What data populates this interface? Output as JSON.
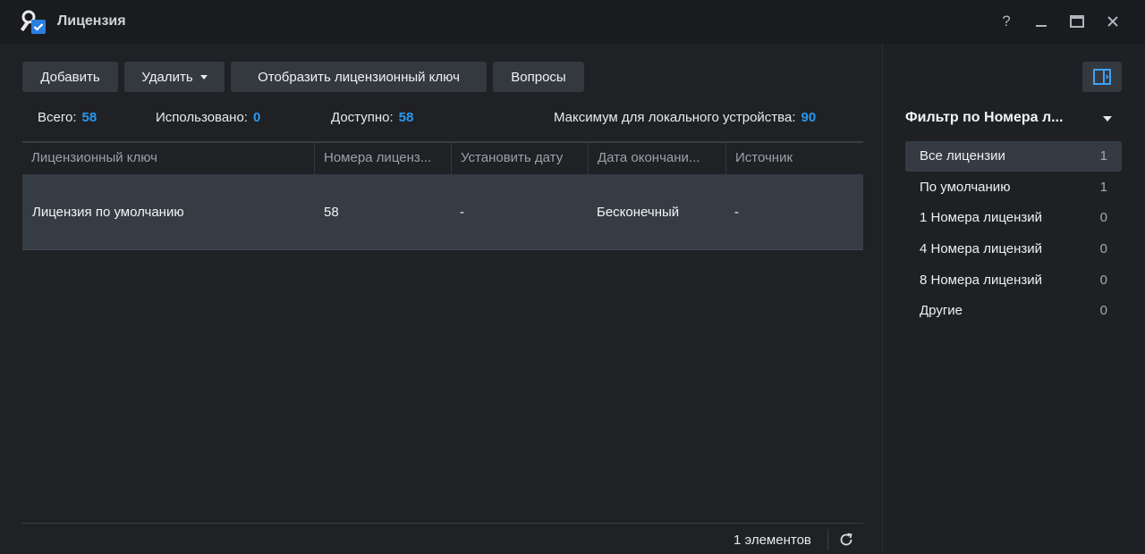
{
  "window": {
    "title": "Лицензия",
    "help_label": "?",
    "icon": "license-key-icon"
  },
  "toolbar": {
    "add_label": "Добавить",
    "delete_label": "Удалить",
    "show_key_label": "Отобразить лицензионный ключ",
    "faq_label": "Вопросы"
  },
  "stats": {
    "total_label": "Всего:",
    "total_value": "58",
    "used_label": "Использовано:",
    "used_value": "0",
    "available_label": "Доступно:",
    "available_value": "58",
    "max_label": "Максимум для локального устройства:",
    "max_value": "90"
  },
  "table": {
    "columns": [
      "Лицензионный ключ",
      "Номера лиценз...",
      "Установить дату",
      "Дата окончани...",
      "Источник"
    ],
    "rows": [
      [
        "Лицензия по умолчанию",
        "58",
        "-",
        "Бесконечный",
        "-"
      ]
    ]
  },
  "footer": {
    "count_label": "1 элементов"
  },
  "filter": {
    "title": "Фильтр по Номера л...",
    "items": [
      {
        "label": "Все лицензии",
        "count": "1"
      },
      {
        "label": "По умолчанию",
        "count": "1"
      },
      {
        "label": "1 Номера лицензий",
        "count": "0"
      },
      {
        "label": "4 Номера лицензий",
        "count": "0"
      },
      {
        "label": "8 Номера лицензий",
        "count": "0"
      },
      {
        "label": "Другие",
        "count": "0"
      }
    ]
  },
  "colors": {
    "accent": "#2b97f1",
    "background": "#1f2125",
    "titlebar": "#1a1b1e",
    "button": "#343940",
    "selected_row": "#363c44"
  }
}
